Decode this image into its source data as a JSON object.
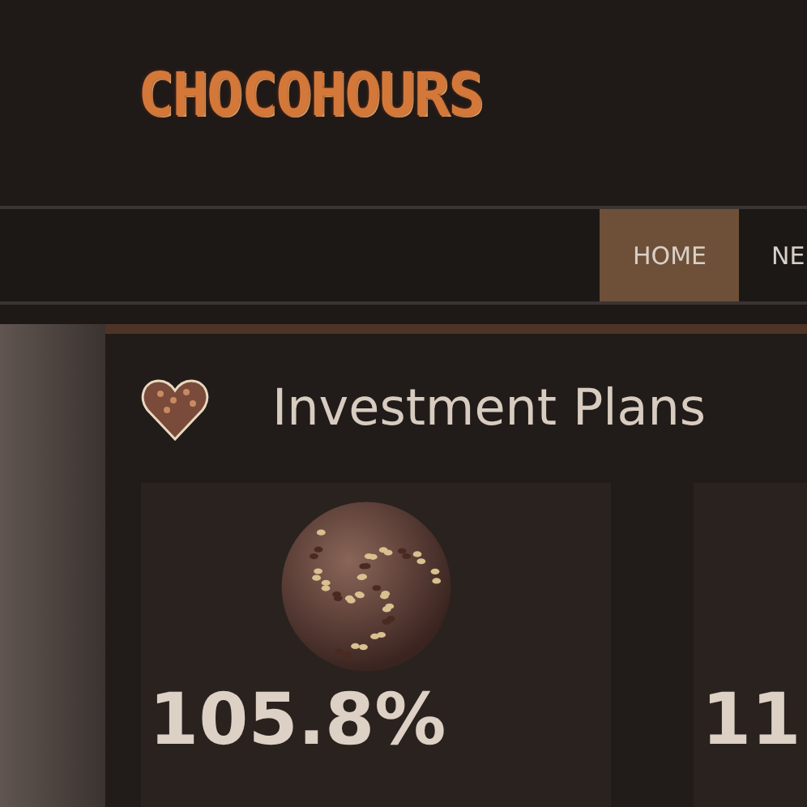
{
  "logo": {
    "text": "CHOCOHOURS"
  },
  "nav": [
    {
      "label": "HOME",
      "selected": true
    },
    {
      "label": "NE",
      "selected": false
    }
  ],
  "section": {
    "title": "Investment Plans"
  },
  "plans": [
    {
      "rate": "105.8%"
    },
    {
      "rate": "11"
    }
  ]
}
